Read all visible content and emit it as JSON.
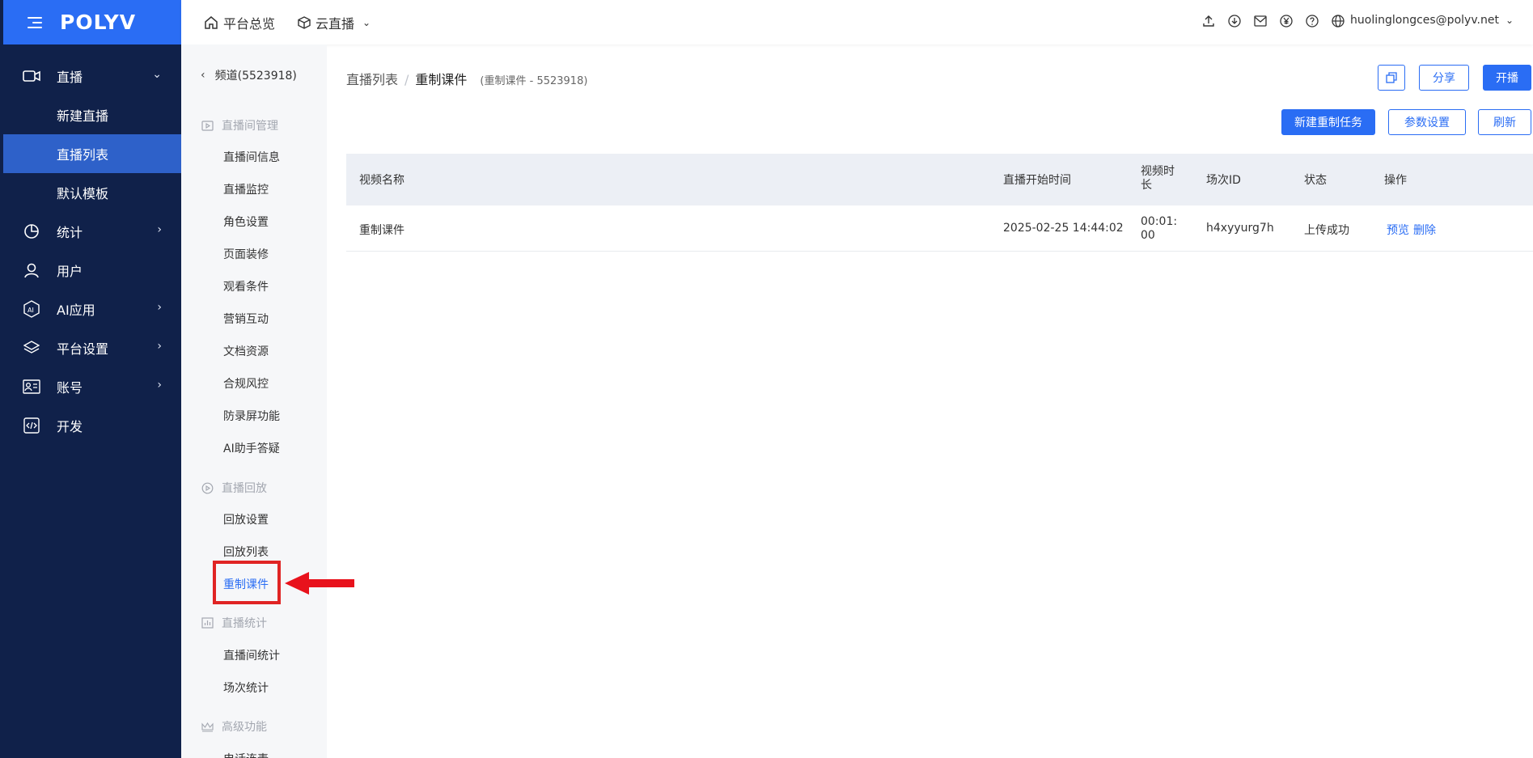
{
  "brand": {
    "logo_text": "POLYV",
    "accent": "#2a6df4",
    "sidebar_bg": "#10214a"
  },
  "header": {
    "home_label": "平台总览",
    "product_label": "云直播",
    "icons": [
      "upload-icon",
      "download-icon",
      "mail-icon",
      "yen-icon",
      "help-icon",
      "globe-icon"
    ],
    "user_email": "huolinglongces@polyv.net"
  },
  "sidebar": {
    "items": [
      {
        "label": "直播",
        "icon": "video-icon",
        "expanded": true
      },
      {
        "label": "新建直播"
      },
      {
        "label": "直播列表",
        "active": true
      },
      {
        "label": "默认模板"
      },
      {
        "label": "统计",
        "icon": "chart-pie-icon"
      },
      {
        "label": "用户",
        "icon": "user-icon"
      },
      {
        "label": "AI应用",
        "icon": "ai-icon"
      },
      {
        "label": "平台设置",
        "icon": "layers-icon"
      },
      {
        "label": "账号",
        "icon": "id-card-icon"
      },
      {
        "label": "开发",
        "icon": "code-icon"
      }
    ]
  },
  "subnav": {
    "channel": "频道(5523918)",
    "groups": [
      {
        "title": "直播间管理",
        "icon": "play-screen-icon",
        "links": [
          "直播间信息",
          "直播监控",
          "角色设置",
          "页面装修",
          "观看条件",
          "营销互动",
          "文档资源",
          "合规风控",
          "防录屏功能",
          "AI助手答疑"
        ]
      },
      {
        "title": "直播回放",
        "icon": "replay-icon",
        "links": [
          "回放设置",
          "回放列表",
          "重制课件"
        ]
      },
      {
        "title": "直播统计",
        "icon": "stats-icon",
        "links": [
          "直播间统计",
          "场次统计"
        ]
      },
      {
        "title": "高级功能",
        "icon": "crown-icon",
        "links": [
          "电话连麦"
        ]
      }
    ],
    "active_link": "重制课件"
  },
  "main": {
    "breadcrumb": {
      "parent": "直播列表",
      "separator": "/",
      "current": "重制课件",
      "meta": "(重制课件 - 5523918)"
    },
    "top_buttons": {
      "share": "分享",
      "start": "开播"
    },
    "actions": {
      "new_task": "新建重制任务",
      "params": "参数设置",
      "refresh": "刷新"
    },
    "table": {
      "columns": [
        "视频名称",
        "直播开始时间",
        "视频时长",
        "场次ID",
        "状态",
        "操作"
      ],
      "rows": [
        {
          "name": "重制课件",
          "start_time": "2025-02-25 14:44:02",
          "duration": "00:01:00",
          "session_id": "h4xyyurg7h",
          "status": "上传成功",
          "ops": [
            "预览",
            "删除"
          ]
        }
      ]
    }
  }
}
